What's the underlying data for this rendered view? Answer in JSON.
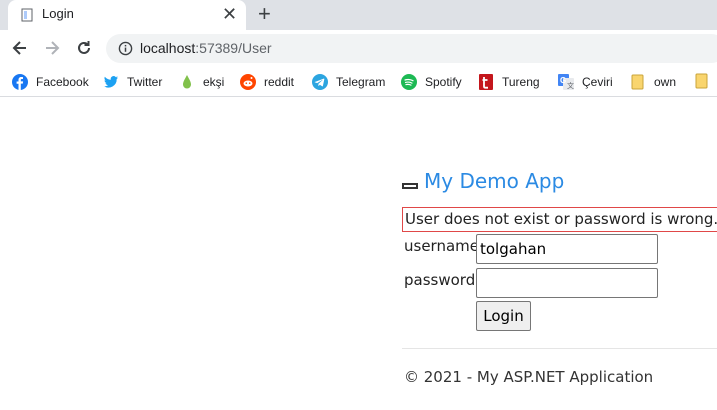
{
  "browser": {
    "tab": {
      "title": "Login",
      "favicon": "page-icon"
    },
    "toolbar": {
      "url_host": "localhost",
      "url_path": ":57389/User"
    },
    "bookmarks": [
      {
        "label": "Facebook",
        "icon": "facebook-icon",
        "color": "#1877f2"
      },
      {
        "label": "Twitter",
        "icon": "twitter-icon",
        "color": "#1da1f2"
      },
      {
        "label": "ekşi",
        "icon": "eksi-icon",
        "color": "#81c14b"
      },
      {
        "label": "reddit",
        "icon": "reddit-icon",
        "color": "#ff4500"
      },
      {
        "label": "Telegram",
        "icon": "telegram-icon",
        "color": "#2ca5e0"
      },
      {
        "label": "Spotify",
        "icon": "spotify-icon",
        "color": "#1db954"
      },
      {
        "label": "Tureng",
        "icon": "tureng-icon",
        "color": "#c4161c"
      },
      {
        "label": "Çeviri",
        "icon": "translate-icon",
        "color": "#4285f4"
      },
      {
        "label": "own",
        "icon": "folder-icon",
        "color": "#f9d56e"
      }
    ]
  },
  "app": {
    "brand": "My Demo App",
    "error": "User does not exist or password is wrong.",
    "form": {
      "username_label": "username",
      "username_value": "tolgahan",
      "password_label": "password",
      "password_value": "",
      "login_label": "Login"
    },
    "footer": "© 2021 - My ASP.NET Application"
  }
}
